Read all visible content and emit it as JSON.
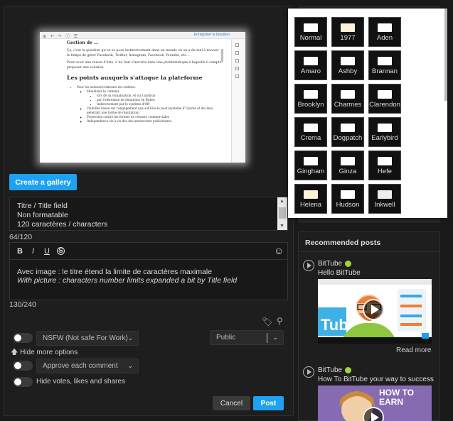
{
  "preview": {
    "doc_top": "Gestion de ...",
    "para1": "Ça, c'est la question qu'on se pose instinctivement dans un monde où on a du mal à trouver le temps de gérer Facebook, Twitter, Instagram, Facebook, Youtube, etc...",
    "para2": "Pour avoir une raison d'être, il lui faut s'inscrire dans une problématique à laquelle il compte proposer une solution.",
    "heading": "Les points auxquels s'attaque la plateforme",
    "li1": "Pour les auteurs/créateurs de contenu:",
    "li1a": "Monétiser le contenu,",
    "li1b": "lors de sa visualisation, et via l'airdrop",
    "li1c": "par l'entremise de donations en Bubes",
    "li1d": "Indirectement par le système d'Off",
    "li2": "Visibilité basée sur l'engagement que sollicite le post (système d'Upvote et de likes, générant une forme de réputation)",
    "li3": "Protection contre les formes de censure commerciales",
    "li4": "Indépendance vis à vis des des annonceurs publicitaires",
    "top_link": "Enregistrer le brouillon"
  },
  "composer": {
    "create_gallery": "Create a gallery",
    "title_placeholder": "Titre  / Title field\nNon formatable\n120 caractères / characters",
    "title_count": "64/120",
    "body_fr": "Avec image : le titre étend la limite de caractères maximale",
    "body_en": "With picture : characters number limits expanded a bit by Title field",
    "body_count": "130/240",
    "nsfw_label": "NSFW (Not safe For Work)",
    "visibility": "Public",
    "hide_options": "Hide more options",
    "approve_label": "Approve each comment",
    "hide_votes": "Hide votes, likes and shares",
    "cancel": "Cancel",
    "post": "Post",
    "toolbar": {
      "bold": "B",
      "italic": "I",
      "underline": "U",
      "strike": "S"
    }
  },
  "filters": [
    "Normal",
    "1977",
    "Aden",
    "Amaro",
    "Ashby",
    "Brannan",
    "Brooklyn",
    "Charmes",
    "Clarendon",
    "Crema",
    "Dogpatch",
    "Earlybird",
    "Gingham",
    "Ginza",
    "Hefe",
    "Helena",
    "Hudson",
    "Inkwell"
  ],
  "recommended": {
    "header": "Recommended posts",
    "posts": [
      {
        "channel": "BitTube",
        "title": "Hello BitTube",
        "read_more": "Read more"
      },
      {
        "channel": "BitTube",
        "title": "How To BitTube your way to success",
        "thumb_text": "HOW TO EARN"
      }
    ]
  },
  "colors": {
    "accent": "#1da1f2",
    "verified": "#a6d13a"
  }
}
